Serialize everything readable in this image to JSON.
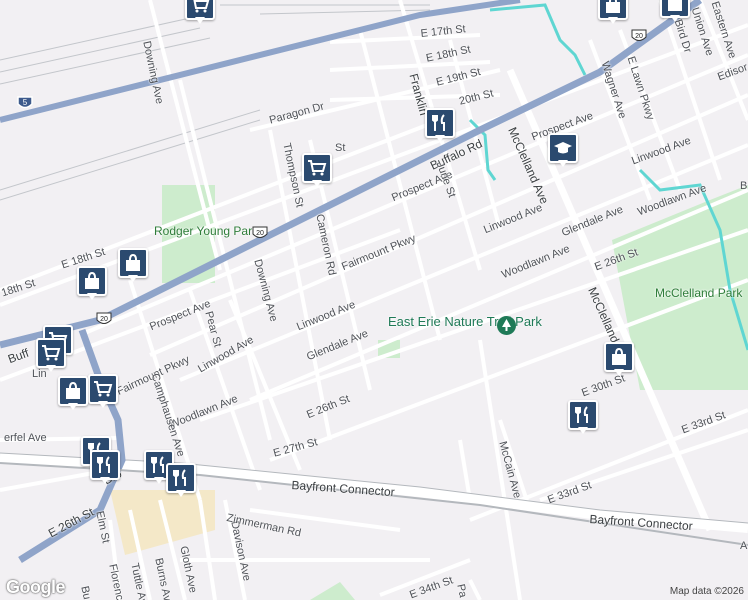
{
  "labels": {
    "e17": "E 17th St",
    "e18": "E 18th St",
    "e19": "E 19th St",
    "e20": "20th St",
    "paragon": "Paragon Dr",
    "downing_n": "Downing Ave",
    "downing_s": "Downing Ave",
    "thompson": "Thompson St",
    "cameron": "Cameron Rd",
    "buffalo": "Buffalo Rd",
    "franklin": "Franklin",
    "mcclelland_n": "McClelland Ave",
    "mcclelland_s": "McClelland",
    "wagner": "Wagner Ave",
    "elawn": "E Lawn Pkwy",
    "union": "Union Ave",
    "eastern": "Eastern Ave",
    "bird": "Bird Dr",
    "edison": "Edisor",
    "prospect_ne": "Prospect Ave",
    "prospect_c": "Prospect Ave",
    "prospect_w": "Prospect Ave",
    "linwood_ne": "Linwood Ave",
    "linwood_c": "Linwood Ave",
    "linwood_e": "Linwood Ave",
    "linwood_w": "Linwood Ave",
    "june": "June St",
    "glendale_e": "Glendale Ave",
    "glendale_w": "Glendale Ave",
    "woodlawn_ne": "Woodlawn Ave",
    "woodlawn_c": "Woodlawn Ave",
    "woodlawn_w": "Woodlawn Ave",
    "fairmount_c": "Fairmount Pkwy",
    "fairmount_w": "Fairmount Pkwy",
    "e26_e": "E 26th St",
    "e26_c": "E 26th St",
    "e26_w": "E 26th St",
    "e27": "E 27th St",
    "e30": "E 30th St",
    "e33_e": "E 33rd St",
    "e33_c": "E 33rd St",
    "e34": "E 34th St",
    "e18_w": "E 18th St",
    "w18": "18th St",
    "bayfront_c": "Bayfront Connector",
    "bayfront_e": "Bayfront Connector",
    "mccain": "McCain Ave",
    "pear": "Pear St",
    "camphausen": "Camphausen Ave",
    "davison": "Davison Ave",
    "gloth": "Gloth Ave",
    "burns": "Burns Ave",
    "tuttle": "Tuttle Ave",
    "florence": "Florence",
    "elm": "Elm St",
    "zimmerman": "Zimmerman Rd",
    "erfel": "erfel Ave",
    "buff": "Buff",
    "lin": "Lin",
    "bro": "Bro",
    "st_frag": "St",
    "b_frag": "B",
    "a_frag": "A",
    "bu_frag": "Bu",
    "pa_frag": "Pa"
  },
  "parks": {
    "rodger": "Rodger Young Park",
    "mcclelland_park": "McClelland Park",
    "nature_trail": "East Erie Nature Trail Park"
  },
  "shields": [
    "5",
    "20",
    "20",
    "20"
  ],
  "pins": [
    {
      "kind": "shopping-cart"
    },
    {
      "kind": "shopping-cart"
    },
    {
      "kind": "restaurant"
    },
    {
      "kind": "school"
    },
    {
      "kind": "shopping-bag"
    },
    {
      "kind": "shopping-bag"
    },
    {
      "kind": "shopping-bag"
    },
    {
      "kind": "shopping-bag"
    },
    {
      "kind": "shopping-bag"
    },
    {
      "kind": "shopping-cart"
    },
    {
      "kind": "shopping-cart"
    },
    {
      "kind": "shopping-cart"
    },
    {
      "kind": "restaurant"
    },
    {
      "kind": "restaurant"
    },
    {
      "kind": "restaurant"
    },
    {
      "kind": "restaurant"
    },
    {
      "kind": "restaurant"
    }
  ],
  "attribution": "Map data ©2026",
  "logo": "Google",
  "colors": {
    "background": "#f2f0f3",
    "road": "#ffffff",
    "highway": "#8fa4c9",
    "park": "#cdeccd",
    "water": "#5fd6d2",
    "pin": "#2b4a6f",
    "rail": "#b4b8bd"
  }
}
